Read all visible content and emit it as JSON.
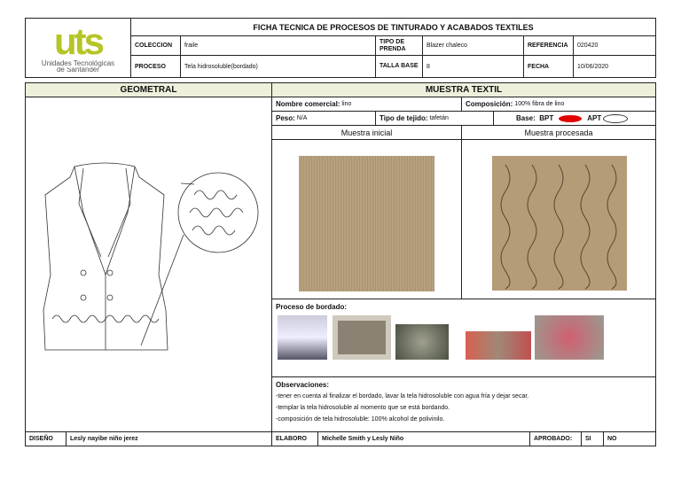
{
  "header": {
    "logo_text": "uts",
    "logo_sub1": "Unidades Tecnológicas",
    "logo_sub2": "de Santander",
    "title": "FICHA TECNICA DE PROCESOS DE TINTURADO Y ACABADOS TEXTILES",
    "coleccion_label": "COLECCION",
    "coleccion": "fraile",
    "tipo_label": "TIPO DE PRENDA",
    "tipo": "Blazer chaleco",
    "referencia_label": "REFERENCIA",
    "referencia": "020420",
    "proceso_label": "PROCESO",
    "proceso": "Tela hidrosoluble(bordado)",
    "talla_label": "TALLA BASE",
    "talla": "8",
    "fecha_label": "FECHA",
    "fecha": "10/06/2020"
  },
  "geometral": {
    "title": "GEOMETRAL"
  },
  "muestra": {
    "title": "MUESTRA TEXTIL",
    "nombre_label": "Nombre comercial:",
    "nombre": "lino",
    "composicion_label": "Composición:",
    "composicion": "100% fibra de lino",
    "peso_label": "Peso:",
    "peso": "N/A",
    "tejido_label": "Tipo de tejido:",
    "tejido": "tafetán",
    "base_label": "Base:",
    "bpt": "BPT",
    "apt": "APT",
    "inicial": "Muestra inicial",
    "procesada": "Muestra procesada",
    "proceso_bordado": "Proceso de bordado:"
  },
  "observaciones": {
    "title": "Observaciones:",
    "items": [
      "-tener en cuenta al finalizar el bordado, lavar la tela hidrosoluble con agua fría y dejar secar.",
      "-templar la tela hidrosoluble al momento que se está bordando.",
      "-composición de tela hidrosoluble: 100% alcohol de polivinilo."
    ]
  },
  "footer": {
    "diseno_label": "DISEÑO",
    "diseno": "Lesly nayibe niño jerez",
    "elaboro_label": "ELABORO",
    "elaboro": "Michelle Smith y Lesly Niño",
    "aprobado_label": "APROBADO:",
    "si": "SI",
    "no": "NO"
  },
  "colors": {
    "logo": "#b5c525",
    "header_bg": "#eef0dc",
    "bpt_fill": "#e00000",
    "fabric": "#b49c78"
  }
}
